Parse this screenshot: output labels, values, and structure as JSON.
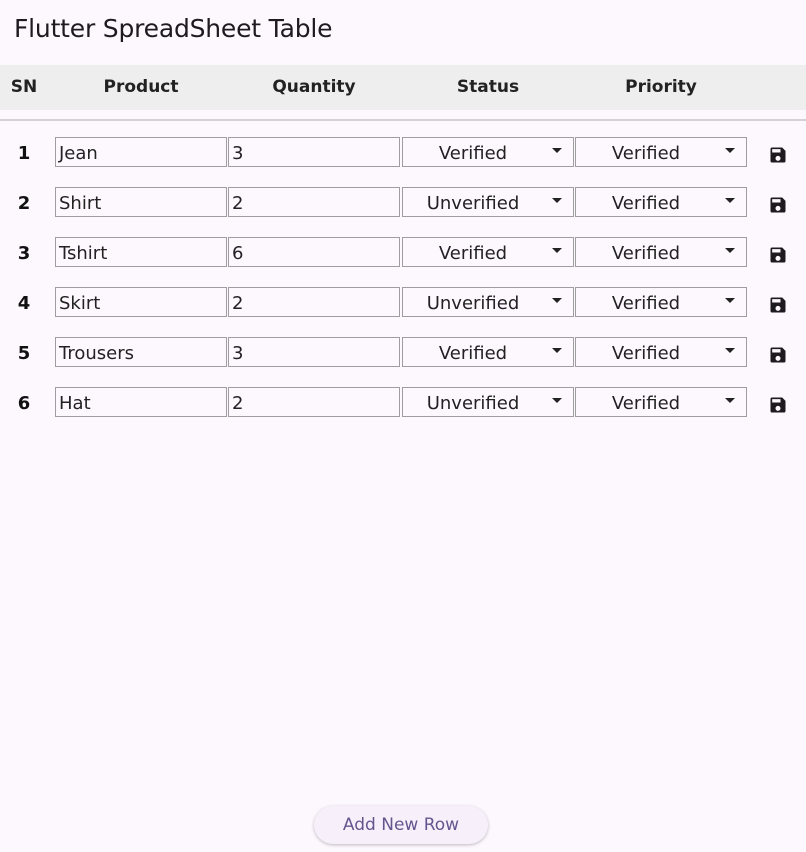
{
  "app": {
    "title": "Flutter SpreadSheet Table"
  },
  "table": {
    "headers": {
      "sn": "SN",
      "product": "Product",
      "quantity": "Quantity",
      "status": "Status",
      "priority": "Priority"
    },
    "rows": [
      {
        "sn": "1",
        "product": "Jean",
        "quantity": "3",
        "status": "Verified",
        "priority": "Verified"
      },
      {
        "sn": "2",
        "product": "Shirt",
        "quantity": "2",
        "status": "Unverified",
        "priority": "Verified"
      },
      {
        "sn": "3",
        "product": "Tshirt",
        "quantity": "6",
        "status": "Verified",
        "priority": "Verified"
      },
      {
        "sn": "4",
        "product": "Skirt",
        "quantity": "2",
        "status": "Unverified",
        "priority": "Verified"
      },
      {
        "sn": "5",
        "product": "Trousers",
        "quantity": "3",
        "status": "Verified",
        "priority": "Verified"
      },
      {
        "sn": "6",
        "product": "Hat",
        "quantity": "2",
        "status": "Unverified",
        "priority": "Verified"
      }
    ],
    "row_action_icon": "save-icon"
  },
  "footer": {
    "add_row_label": "Add New Row"
  },
  "colors": {
    "background": "#fdf7fe",
    "header_background": "#eeeeee",
    "accent": "#65558f",
    "icon": "#1d1b20"
  }
}
